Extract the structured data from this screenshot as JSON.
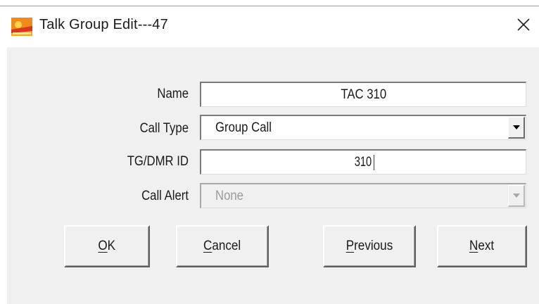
{
  "window": {
    "title": "Talk Group Edit---47",
    "close_glyph": "✕"
  },
  "form": {
    "name": {
      "label": "Name",
      "value": "TAC 310"
    },
    "call_type": {
      "label": "Call Type",
      "value": "Group Call"
    },
    "tg_dmr_id": {
      "label": "TG/DMR ID",
      "value": "310"
    },
    "call_alert": {
      "label": "Call Alert",
      "value": "None"
    }
  },
  "buttons": {
    "ok": "OK",
    "cancel": "Cancel",
    "previous": "Previous",
    "next": "Next"
  },
  "icons": {
    "app": "app-logo-icon",
    "close": "close-icon",
    "dropdown": "chevron-down-icon"
  },
  "colors": {
    "dialog_bg": "#f0f0f0",
    "field_bg": "#ffffff",
    "app_icon_orange": "#f08a1c",
    "app_icon_red": "#d8361e"
  }
}
